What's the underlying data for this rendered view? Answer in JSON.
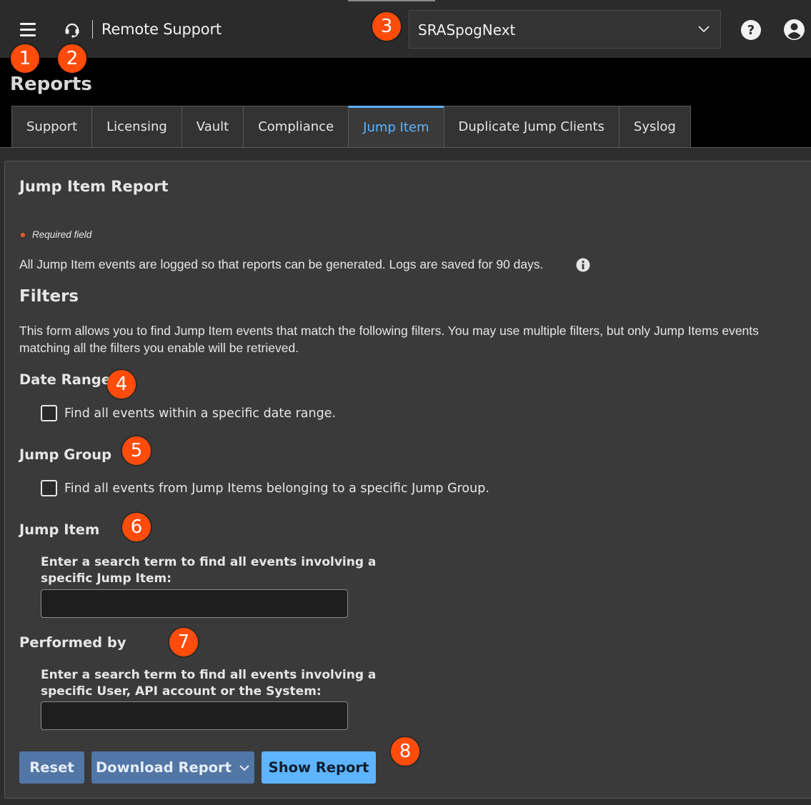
{
  "header": {
    "app_title": "Remote Support",
    "site_selector_value": "SRASpogNext",
    "menu_icon": "hamburger-menu-icon",
    "app_icon": "headset-icon",
    "help_icon": "help-icon",
    "user_icon": "user-account-icon"
  },
  "page": {
    "title": "Reports"
  },
  "tabs": [
    {
      "label": "Support"
    },
    {
      "label": "Licensing"
    },
    {
      "label": "Vault"
    },
    {
      "label": "Compliance"
    },
    {
      "label": "Jump Item",
      "active": true
    },
    {
      "label": "Duplicate Jump Clients"
    },
    {
      "label": "Syslog"
    }
  ],
  "report": {
    "title": "Jump Item Report",
    "required_note": "Required field",
    "intro": "All Jump Item events are logged so that reports can be generated. Logs are saved for 90 days.",
    "filters_heading": "Filters",
    "filters_desc": "This form allows you to find Jump Item events that match the following filters. You may use multiple filters, but only Jump Items events matching all the filters you enable will be retrieved.",
    "date_range": {
      "label": "Date Range",
      "checkbox_label": "Find all events within a specific date range.",
      "checked": false
    },
    "jump_group": {
      "label": "Jump Group",
      "checkbox_label": "Find all events from Jump Items belonging to a specific Jump Group.",
      "checked": false
    },
    "jump_item": {
      "label": "Jump Item",
      "field_label": "Enter a search term to find all events involving a specific Jump Item:",
      "value": ""
    },
    "performed_by": {
      "label": "Performed by",
      "field_label": "Enter a search term to find all events involving a specific User, API account or the System:",
      "value": ""
    }
  },
  "buttons": {
    "reset": "Reset",
    "download": "Download Report",
    "show": "Show Report"
  },
  "badges": [
    "1",
    "2",
    "3",
    "4",
    "5",
    "6",
    "7",
    "8"
  ],
  "colors": {
    "accent": "#5db3ff",
    "badge": "#ff4c0b",
    "button_secondary": "#5276a6",
    "button_primary": "#5eb4ff",
    "required_dot": "#ff5a1f"
  }
}
